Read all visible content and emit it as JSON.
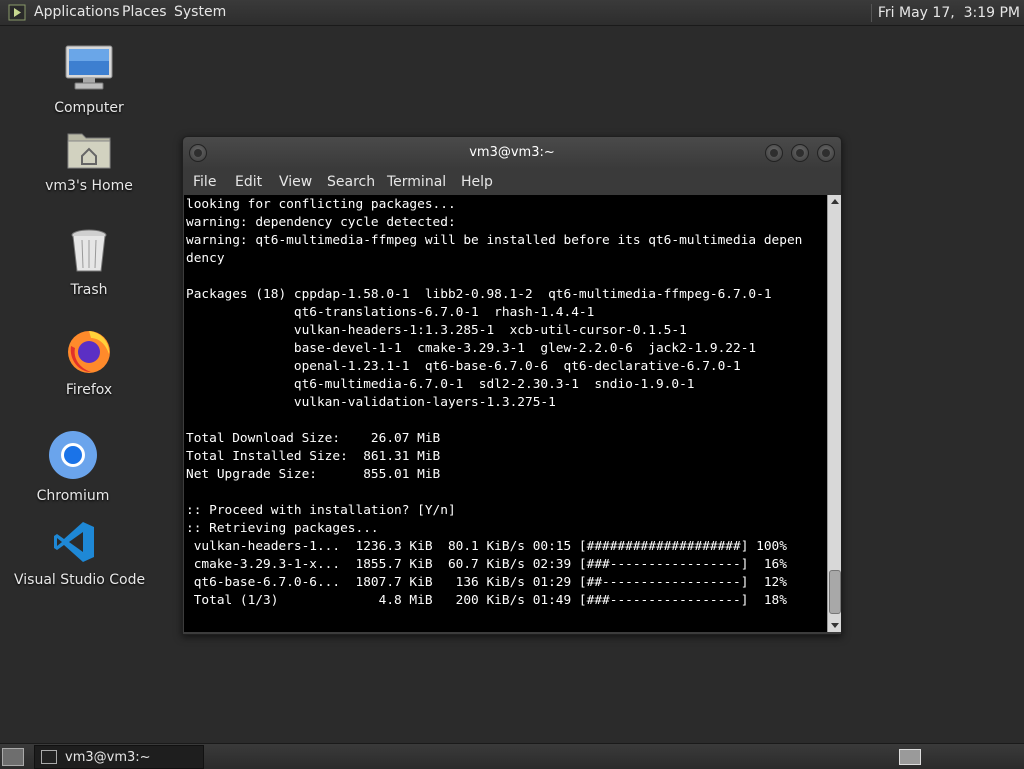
{
  "top_panel": {
    "menus": [
      "Applications",
      "Places",
      "System"
    ],
    "clock": "Fri May 17,  3:19 PM"
  },
  "desktop_icons": [
    {
      "label": "Computer",
      "icon": "computer-icon"
    },
    {
      "label": "vm3's Home",
      "icon": "home-folder-icon"
    },
    {
      "label": "Trash",
      "icon": "trash-icon"
    },
    {
      "label": "Firefox",
      "icon": "firefox-icon"
    },
    {
      "label": "Chromium",
      "icon": "chromium-icon"
    },
    {
      "label": "Visual Studio Code",
      "icon": "vscode-icon"
    }
  ],
  "window": {
    "title": "vm3@vm3:~",
    "menu": [
      "File",
      "Edit",
      "View",
      "Search",
      "Terminal",
      "Help"
    ],
    "terminal_lines": [
      "looking for conflicting packages...",
      "warning: dependency cycle detected:",
      "warning: qt6-multimedia-ffmpeg will be installed before its qt6-multimedia depen",
      "dency",
      "",
      "Packages (18) cppdap-1.58.0-1  libb2-0.98.1-2  qt6-multimedia-ffmpeg-6.7.0-1",
      "              qt6-translations-6.7.0-1  rhash-1.4.4-1",
      "              vulkan-headers-1:1.3.285-1  xcb-util-cursor-0.1.5-1",
      "              base-devel-1-1  cmake-3.29.3-1  glew-2.2.0-6  jack2-1.9.22-1",
      "              openal-1.23.1-1  qt6-base-6.7.0-6  qt6-declarative-6.7.0-1",
      "              qt6-multimedia-6.7.0-1  sdl2-2.30.3-1  sndio-1.9.0-1",
      "              vulkan-validation-layers-1.3.275-1",
      "",
      "Total Download Size:    26.07 MiB",
      "Total Installed Size:  861.31 MiB",
      "Net Upgrade Size:      855.01 MiB",
      "",
      ":: Proceed with installation? [Y/n]",
      ":: Retrieving packages...",
      " vulkan-headers-1...  1236.3 KiB  80.1 KiB/s 00:15 [####################] 100%",
      " cmake-3.29.3-1-x...  1855.7 KiB  60.7 KiB/s 02:39 [###-----------------]  16%",
      " qt6-base-6.7.0-6...  1807.7 KiB   136 KiB/s 01:29 [##------------------]  12%",
      " Total (1/3)             4.8 MiB   200 KiB/s 01:49 [###-----------------]  18%"
    ]
  },
  "taskbar": {
    "task_label": "vm3@vm3:~"
  }
}
